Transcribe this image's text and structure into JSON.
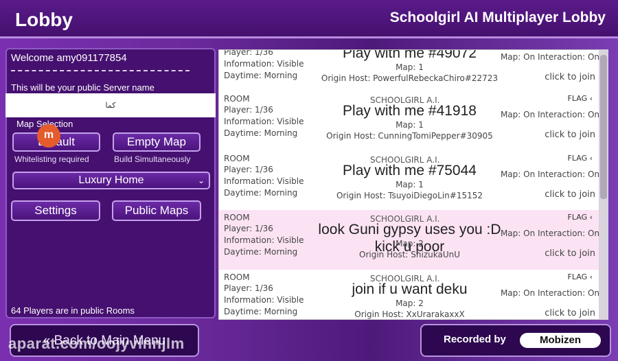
{
  "header": {
    "title": "Lobby",
    "subtitle": "Schoolgirl AI Multiplayer Lobby"
  },
  "sidebar": {
    "welcome": "Welcome amy091177854",
    "server_name_label": "This will be your public Server name",
    "server_name_value": "کما",
    "map_selection_label": "Map Selection",
    "default_button": "Default",
    "empty_map_button": "Empty Map",
    "whitelisting_hint": "Whitelisting required",
    "build_hint": "Build Simultaneously",
    "map_dropdown": "Luxury Home",
    "settings_button": "Settings",
    "public_maps_button": "Public Maps",
    "players_status": "64 Players are in public Rooms"
  },
  "footer": {
    "back_button": "« Back to Main Menu",
    "recorded_by": "Recorded by",
    "recorder_logo": "Mobizen",
    "watermark": "aparat.com/oojyvinnjlm"
  },
  "rooms": [
    {
      "room": "",
      "player": "Player: 1/36",
      "information": "Information: Visible",
      "daytime": "Daytime: Morning",
      "game": "",
      "flag": "",
      "name": "Play with me #49072",
      "map_info": "Map: On Interaction: On",
      "map": "Map: 1",
      "host": "Origin Host: PowerfulRebeckaChiro#22723",
      "join": "click to join"
    },
    {
      "room": "ROOM",
      "player": "Player: 1/36",
      "information": "Information: Visible",
      "daytime": "Daytime: Morning",
      "game": "SCHOOLGIRL A.I.",
      "flag": "FLAG ‹",
      "name": "Play with me #41918",
      "map_info": "Map: On Interaction: On",
      "map": "Map: 1",
      "host": "Origin Host: CunningTomiPepper#30905",
      "join": "click to join"
    },
    {
      "room": "ROOM",
      "player": "Player: 1/36",
      "information": "Information: Visible",
      "daytime": "Daytime: Morning",
      "game": "SCHOOLGIRL A.I.",
      "flag": "FLAG ‹",
      "name": "Play with me #75044",
      "map_info": "Map: On Interaction: On",
      "map": "Map: 1",
      "host": "Origin Host: TsuyoiDiegoLin#15152",
      "join": "click to join"
    },
    {
      "room": "ROOM",
      "player": "Player: 1/36",
      "information": "Information: Visible",
      "daytime": "Daytime: Morning",
      "game": "SCHOOLGIRL A.I.",
      "flag": "FLAG ‹",
      "name": "look Guni gypsy uses you :D kick u poor",
      "map_info": "Map: On Interaction: On",
      "map": "Map: 2",
      "host": "Origin Host: ShizukaUnU",
      "join": "click to join"
    },
    {
      "room": "ROOM",
      "player": "Player: 1/36",
      "information": "Information: Visible",
      "daytime": "Daytime: Morning",
      "game": "SCHOOLGIRL A.I.",
      "flag": "FLAG ‹",
      "name": "join if u want deku",
      "map_info": "Map: On Interaction: On",
      "map": "Map: 2",
      "host": "Origin Host: XxUrarakaxxX",
      "join": "click to join"
    }
  ]
}
